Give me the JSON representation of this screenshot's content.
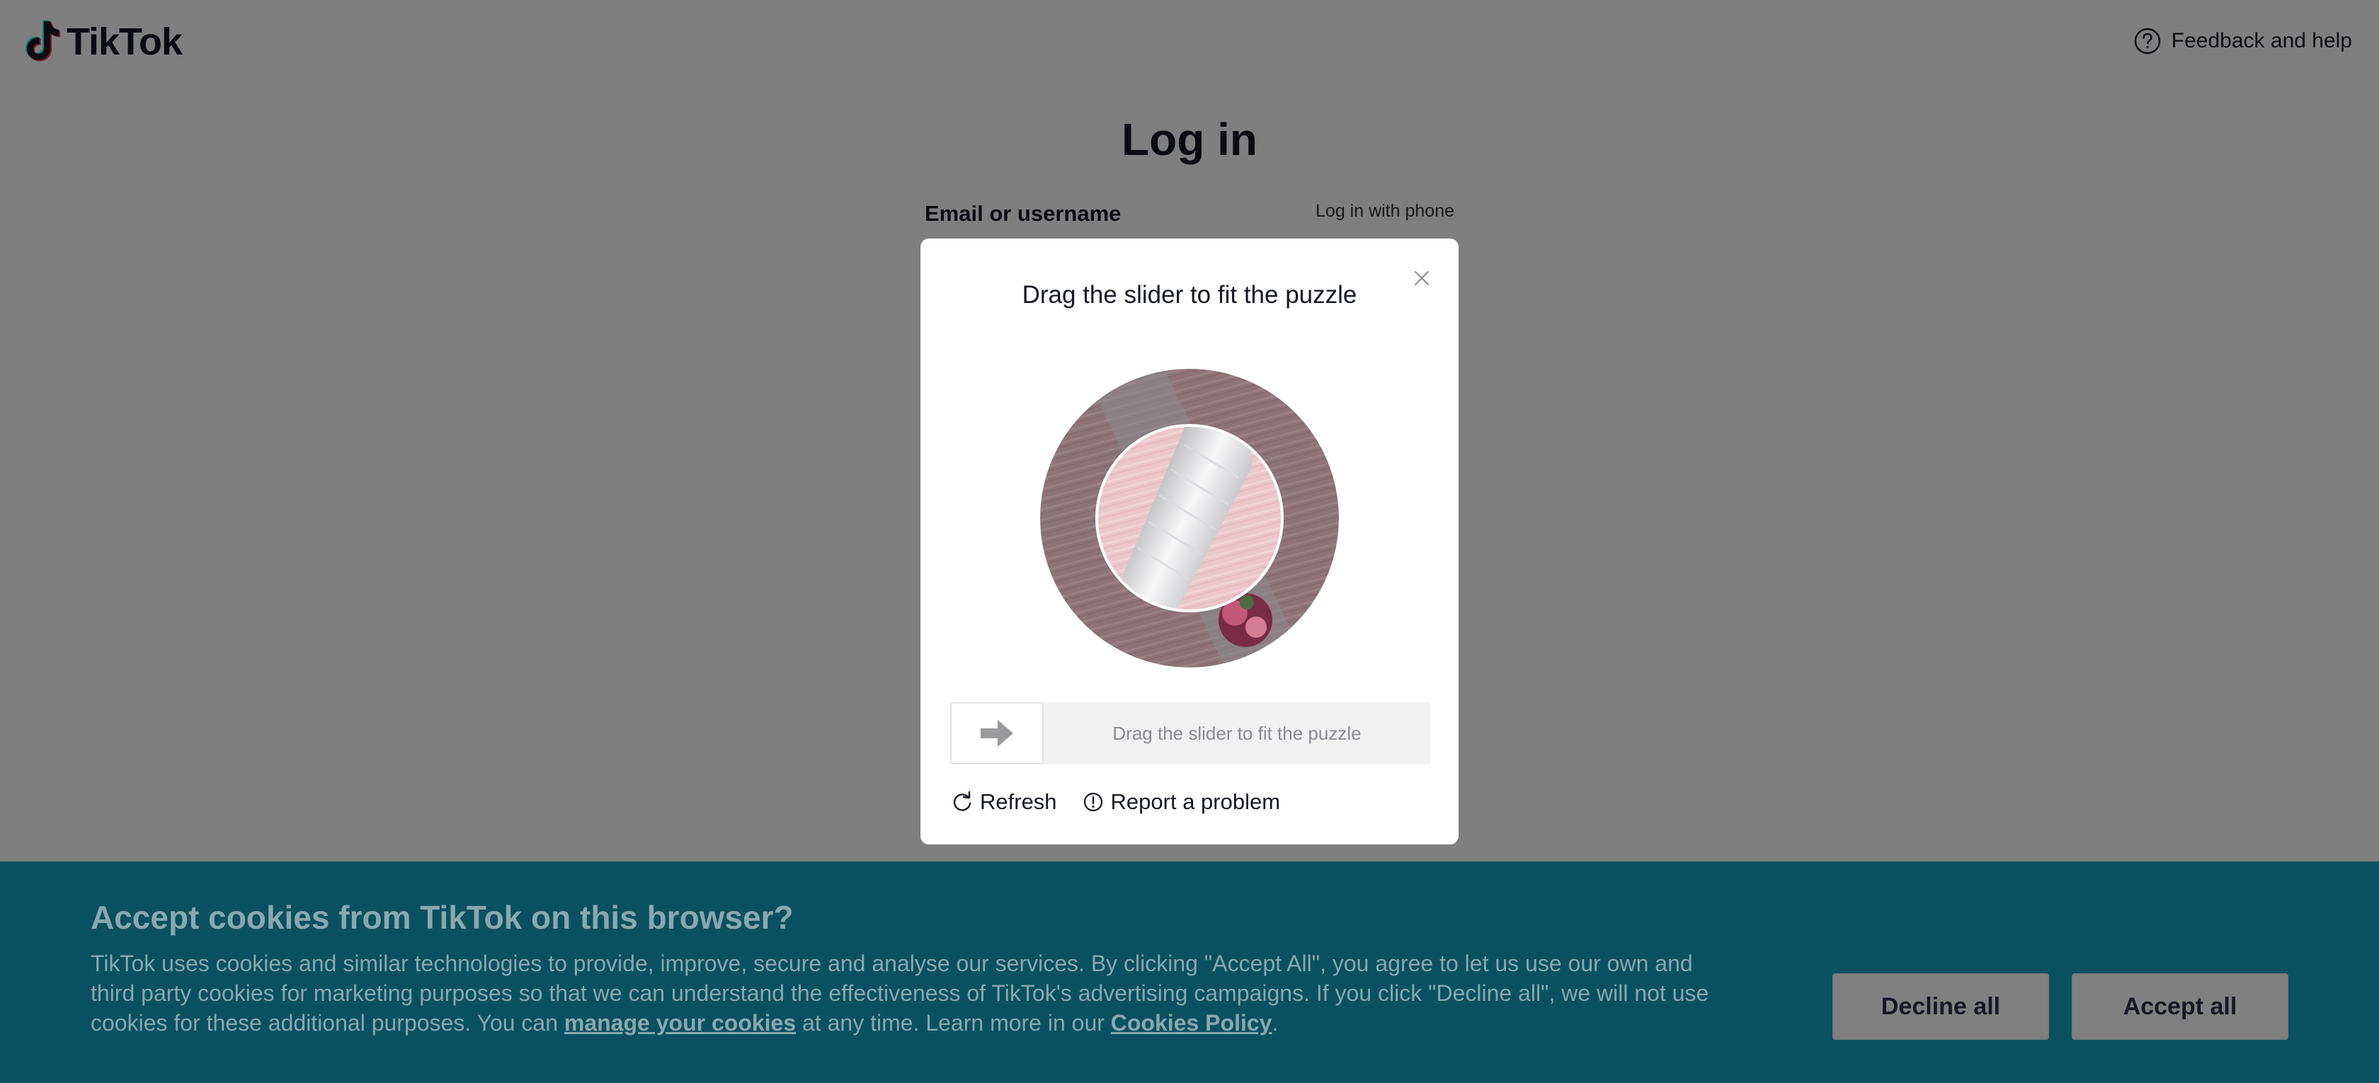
{
  "header": {
    "logo_text": "TikTok",
    "help_label": "Feedback and help"
  },
  "login": {
    "title": "Log in",
    "email_label": "Email or username",
    "phone_link": "Log in with phone"
  },
  "captcha": {
    "title": "Drag the slider to fit the puzzle",
    "slider_hint": "Drag the slider to fit the puzzle",
    "slider_progress": 0,
    "refresh_label": "Refresh",
    "report_label": "Report a problem"
  },
  "cookies": {
    "title": "Accept cookies from TikTok on this browser?",
    "body_text": "TikTok uses cookies and similar technologies to provide, improve, secure and analyse our services. By clicking \"Accept All\", you agree to let us use our own and third party cookies for marketing purposes so that we can understand the effectiveness of TikTok's advertising campaigns. If you click \"Decline all\", we will not use cookies for these additional purposes. You can ",
    "manage_link": "manage your cookies",
    "middle_text": " at any time. Learn more in our ",
    "policy_link": "Cookies Policy",
    "end_text": ".",
    "decline_label": "Decline all",
    "accept_label": "Accept all"
  },
  "colors": {
    "cookie_banner_bg": "#095161",
    "overlay": "rgba(0,0,0,0.5)"
  }
}
